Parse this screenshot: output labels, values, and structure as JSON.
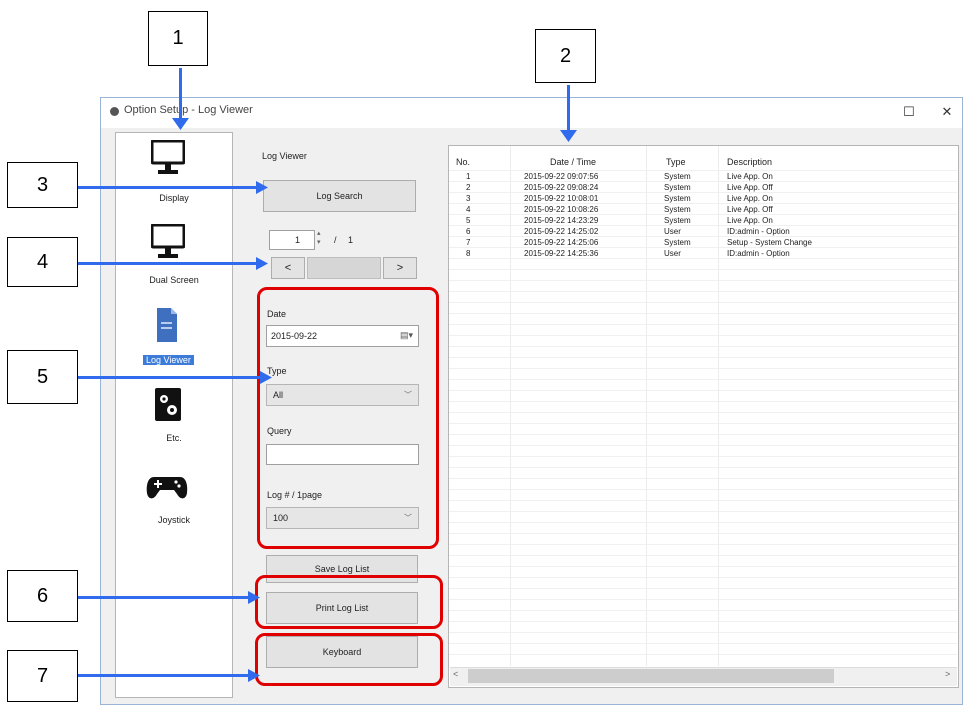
{
  "window": {
    "title": "Option Setup - Log Viewer",
    "controls": {
      "maximize": "☐",
      "close": "✕"
    }
  },
  "sidebar": {
    "items": [
      {
        "label": "Display",
        "icon": "monitor-icon"
      },
      {
        "label": "Dual Screen",
        "icon": "monitor-icon"
      },
      {
        "label": "Log Viewer",
        "icon": "document-icon",
        "selected": true
      },
      {
        "label": "Etc.",
        "icon": "gears-icon"
      },
      {
        "label": "Joystick",
        "icon": "gamepad-icon"
      }
    ]
  },
  "panel": {
    "section_label": "Log Viewer",
    "log_search_button": "Log Search",
    "page": {
      "current": "1",
      "separator": "/",
      "total": "1"
    },
    "nav": {
      "prev": "<",
      "next": ">"
    },
    "date_label": "Date",
    "date_value": "2015-09-22",
    "type_label": "Type",
    "type_value": "All",
    "query_label": "Query",
    "query_value": "",
    "per_page_label": "Log # / 1page",
    "per_page_value": "100",
    "save_button": "Save Log List",
    "print_button": "Print Log List",
    "keyboard_button": "Keyboard"
  },
  "log_table": {
    "headers": {
      "no": "No.",
      "datetime": "Date / Time",
      "type": "Type",
      "description": "Description"
    },
    "rows": [
      {
        "no": "1",
        "datetime": "2015-09-22 09:07:56",
        "type": "System",
        "description": "Live App. On"
      },
      {
        "no": "2",
        "datetime": "2015-09-22 09:08:24",
        "type": "System",
        "description": "Live App. Off"
      },
      {
        "no": "3",
        "datetime": "2015-09-22 10:08:01",
        "type": "System",
        "description": "Live App. On"
      },
      {
        "no": "4",
        "datetime": "2015-09-22 10:08:26",
        "type": "System",
        "description": "Live App. Off"
      },
      {
        "no": "5",
        "datetime": "2015-09-22 14:23:29",
        "type": "System",
        "description": "Live App. On"
      },
      {
        "no": "6",
        "datetime": "2015-09-22 14:25:02",
        "type": "User",
        "description": "ID:admin - Option"
      },
      {
        "no": "7",
        "datetime": "2015-09-22 14:25:06",
        "type": "System",
        "description": "Setup - System Change"
      },
      {
        "no": "8",
        "datetime": "2015-09-22 14:25:36",
        "type": "User",
        "description": "ID:admin - Option"
      }
    ],
    "scroll": {
      "left": "<",
      "right": ">"
    }
  },
  "annotations": {
    "labels": [
      "1",
      "2",
      "3",
      "4",
      "5",
      "6",
      "7"
    ]
  },
  "colors": {
    "pointer": "#2f6bec",
    "highlight": "#e00000",
    "selected": "#3d7bd9"
  }
}
